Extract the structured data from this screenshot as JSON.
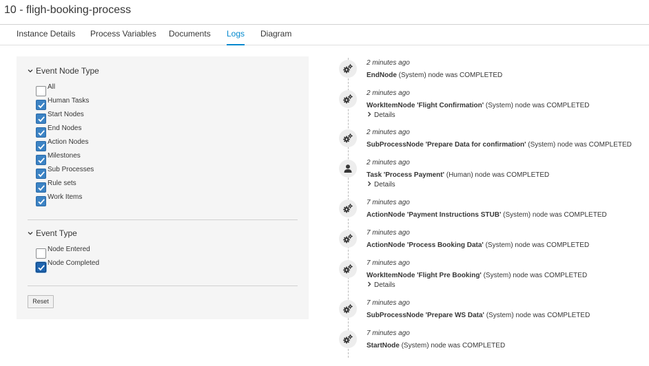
{
  "header": {
    "title": "10 - fligh-booking-process"
  },
  "tabs": [
    {
      "label": "Instance Details"
    },
    {
      "label": "Process Variables"
    },
    {
      "label": "Documents"
    },
    {
      "label": "Logs"
    },
    {
      "label": "Diagram"
    }
  ],
  "active_tab": "Logs",
  "filters": {
    "event_node_type": {
      "title": "Event Node Type",
      "options": [
        {
          "label": "All",
          "checked": false
        },
        {
          "label": "Human Tasks",
          "checked": true
        },
        {
          "label": "Start Nodes",
          "checked": true
        },
        {
          "label": "End Nodes",
          "checked": true
        },
        {
          "label": "Action Nodes",
          "checked": true
        },
        {
          "label": "Milestones",
          "checked": true
        },
        {
          "label": "Sub Processes",
          "checked": true
        },
        {
          "label": "Rule sets",
          "checked": true
        },
        {
          "label": "Work Items",
          "checked": true
        }
      ]
    },
    "event_type": {
      "title": "Event Type",
      "options": [
        {
          "label": "Node Entered",
          "checked": false
        },
        {
          "label": "Node Completed",
          "checked": true
        }
      ]
    },
    "reset_label": "Reset"
  },
  "logs": [
    {
      "icon": "gears-icon",
      "time": "2 minutes ago",
      "name": "EndNode",
      "rest": " (System) node was COMPLETED",
      "details": ""
    },
    {
      "icon": "gears-icon",
      "time": "2 minutes ago",
      "name": "WorkItemNode 'Flight Confirmation'",
      "rest": " (System) node was COMPLETED",
      "details": "Details"
    },
    {
      "icon": "gears-icon",
      "time": "2 minutes ago",
      "name": "SubProcessNode 'Prepare Data for confirmation'",
      "rest": " (System) node was COMPLETED",
      "details": ""
    },
    {
      "icon": "user-icon",
      "time": "2 minutes ago",
      "name": "Task 'Process Payment'",
      "rest": " (Human) node was COMPLETED",
      "details": "Details"
    },
    {
      "icon": "gears-icon",
      "time": "7 minutes ago",
      "name": "ActionNode 'Payment Instructions STUB'",
      "rest": " (System) node was COMPLETED",
      "details": ""
    },
    {
      "icon": "gears-icon",
      "time": "7 minutes ago",
      "name": "ActionNode 'Process Booking Data'",
      "rest": " (System) node was COMPLETED",
      "details": ""
    },
    {
      "icon": "gears-icon",
      "time": "7 minutes ago",
      "name": "WorkItemNode 'Flight Pre Booking'",
      "rest": " (System) node was COMPLETED",
      "details": "Details"
    },
    {
      "icon": "gears-icon",
      "time": "7 minutes ago",
      "name": "SubProcessNode 'Prepare WS Data'",
      "rest": " (System) node was COMPLETED",
      "details": ""
    },
    {
      "icon": "gears-icon",
      "time": "7 minutes ago",
      "name": "StartNode",
      "rest": " (System) node was COMPLETED",
      "details": ""
    }
  ]
}
